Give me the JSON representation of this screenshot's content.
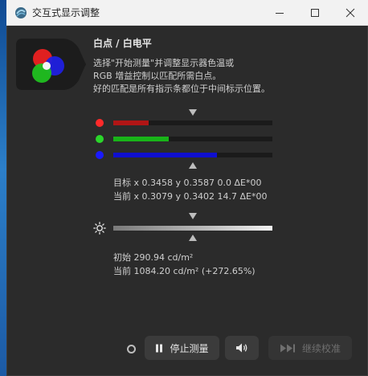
{
  "window": {
    "title": "交互式显示调整"
  },
  "header": {
    "heading": "白点 / 白电平",
    "description_lines": [
      "选择\"开始测量\"并调整显示器色温或",
      "RGB 增益控制以匹配所需白点。",
      "好的匹配是所有指示条都位于中间标示位置。"
    ]
  },
  "rgb_bars": [
    {
      "name": "red",
      "color": "#ff2a2a",
      "fill_color": "#b01515",
      "level": 0.22
    },
    {
      "name": "green",
      "color": "#2bd62b",
      "fill_color": "#19b319",
      "level": 0.35
    },
    {
      "name": "blue",
      "color": "#1a1aff",
      "fill_color": "#0f0fcf",
      "level": 0.65
    }
  ],
  "chromaticity": {
    "target": "目标 x 0.3458 y 0.3587 0.0 ΔE*00",
    "current": "当前 x 0.3079 y 0.3402 14.7 ΔE*00"
  },
  "luminance": {
    "initial": "初始 290.94 cd/m²",
    "current": "当前 1084.20 cd/m² (+272.65%)"
  },
  "buttons": {
    "stop_label": "停止测量",
    "continue_label": "继续校准"
  }
}
